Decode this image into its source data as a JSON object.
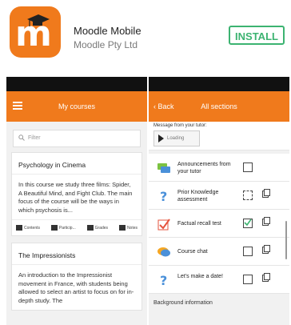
{
  "store": {
    "app_name": "Moodle Mobile",
    "developer": "Moodle Pty Ltd",
    "install_label": "INSTALL",
    "icon_letter": "m",
    "accent_color": "#f07a1c",
    "install_color": "#3cb371"
  },
  "left_screen": {
    "nav_title": "My courses",
    "filter_placeholder": "Filter",
    "courses": [
      {
        "title": "Psychology in Cinema",
        "description": "In this course we study three films: Spider, A Beautiful Mind, and Fight Club. The main focus of the course will be the ways in which psychosis is...",
        "actions": [
          "Contents",
          "Particip...",
          "Grades",
          "Notes"
        ]
      },
      {
        "title": "The Impressionists",
        "description": "An introduction to the Impressionist movement in France, with students being allowed to select an artist to focus on for in-depth study. The"
      }
    ]
  },
  "right_screen": {
    "back_label": "Back",
    "nav_title": "All sections",
    "message_label": "Message from your tutor:",
    "media_label": "Loading",
    "activities": [
      {
        "name": "Announcements from your tutor",
        "icon": "forum-icon",
        "completed": false,
        "has_copy": false
      },
      {
        "name": "Prior Knowledge assessment",
        "icon": "question-icon",
        "completed": false,
        "has_copy": true
      },
      {
        "name": "Factual recall test",
        "icon": "quiz-icon",
        "completed": true,
        "has_copy": true
      },
      {
        "name": "Course chat",
        "icon": "chat-icon",
        "completed": false,
        "has_copy": true
      },
      {
        "name": "Let's make a date!",
        "icon": "question-icon",
        "completed": false,
        "has_copy": true
      }
    ],
    "section_footer": "Background information"
  }
}
